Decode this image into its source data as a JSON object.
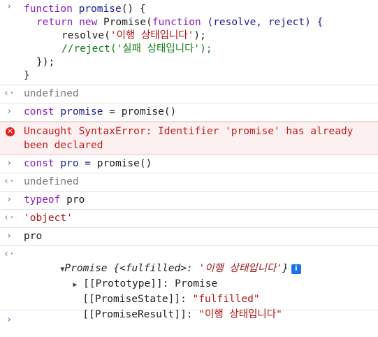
{
  "entries": {
    "input1": {
      "prompt_glyph": "›",
      "l1a": "function",
      "l1b": " promise",
      "l1c": "() {",
      "l2a": "return new",
      "l2b": " Promise",
      "l2c": "(",
      "l2d": "function",
      "l2e": " (resolve, reject) {",
      "l3a": "resolve",
      "l3b": "(",
      "l3c": "'이행 상태입니다'",
      "l3d": ");",
      "l4": "//reject('실패 상태입니다');",
      "l5": "});",
      "l6": "}"
    },
    "result1": {
      "glyph": "‹·",
      "text": "undefined"
    },
    "input2": {
      "glyph": "›",
      "a": "const",
      "b": " promise",
      "c": " = ",
      "d": "promise",
      "e": "()"
    },
    "error": {
      "line1": "Uncaught SyntaxError: Identifier 'promise' has already",
      "line2": "been declared"
    },
    "input3": {
      "glyph": "›",
      "a": "const",
      "b": " pro = ",
      "c": "promise",
      "d": "()"
    },
    "result3": {
      "glyph": "‹·",
      "text": "undefined"
    },
    "input4": {
      "glyph": "›",
      "a": "typeof",
      "b": " pro"
    },
    "result4": {
      "glyph": "‹·",
      "text": "'object'"
    },
    "input5": {
      "glyph": "›",
      "text": "pro"
    },
    "result5": {
      "glyph": "‹·",
      "toggle": "▼",
      "summary_name": "Promise",
      "summary_open": " {<fulfilled>: ",
      "summary_value": "'이행 상태입니다'",
      "summary_close": "}",
      "info": "i",
      "proto_toggle": "▶",
      "proto_key": "[[Prototype]]",
      "proto_val": "Promise",
      "state_key": "[[PromiseState]]",
      "state_val": "\"fulfilled\"",
      "result_key": "[[PromiseResult]]",
      "result_val": "\"이행 상태입니다\""
    },
    "prompt": {
      "glyph": "›"
    }
  }
}
